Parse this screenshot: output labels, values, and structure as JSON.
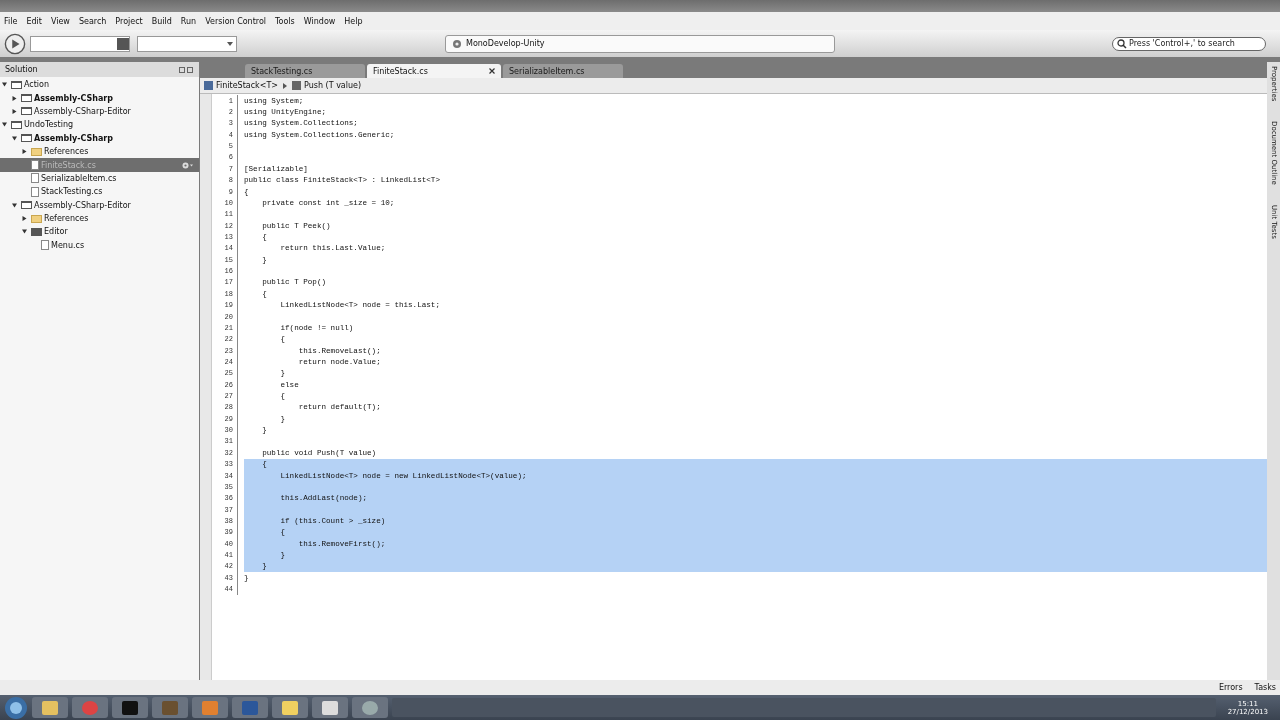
{
  "menu": [
    "File",
    "Edit",
    "View",
    "Search",
    "Project",
    "Build",
    "Run",
    "Version Control",
    "Tools",
    "Window",
    "Help"
  ],
  "toolbar": {
    "status": "MonoDevelop-Unity",
    "search": {
      "placeholder": "Press 'Control+,' to search"
    }
  },
  "solution": {
    "title": "Solution",
    "tree": [
      {
        "label": "Action",
        "kind": "solution",
        "startup": false,
        "expanded": true,
        "selected": false,
        "children": [
          {
            "label": "Assembly-CSharp",
            "kind": "project",
            "startup": true,
            "expanded": false,
            "selected": false
          },
          {
            "label": "Assembly-CSharp-Editor",
            "kind": "project",
            "startup": false,
            "expanded": false,
            "selected": false
          }
        ]
      },
      {
        "label": "UndoTesting",
        "kind": "solution",
        "startup": false,
        "expanded": true,
        "selected": false,
        "children": [
          {
            "label": "Assembly-CSharp",
            "kind": "project",
            "startup": true,
            "expanded": true,
            "selected": false,
            "children": [
              {
                "label": "References",
                "kind": "folder",
                "startup": false,
                "expanded": false,
                "selected": false
              },
              {
                "label": "FiniteStack.cs",
                "kind": "file",
                "startup": false,
                "selected": true
              },
              {
                "label": "SerializableItem.cs",
                "kind": "file",
                "startup": false,
                "selected": false
              },
              {
                "label": "StackTesting.cs",
                "kind": "file",
                "startup": false,
                "selected": false
              }
            ]
          },
          {
            "label": "Assembly-CSharp-Editor",
            "kind": "project",
            "startup": false,
            "expanded": true,
            "selected": false,
            "children": [
              {
                "label": "References",
                "kind": "folder",
                "startup": false,
                "expanded": false,
                "selected": false
              },
              {
                "label": "Editor",
                "kind": "dir",
                "startup": false,
                "expanded": true,
                "selected": false,
                "children": [
                  {
                    "label": "Menu.cs",
                    "kind": "file",
                    "startup": false,
                    "selected": false
                  }
                ]
              }
            ]
          }
        ]
      }
    ]
  },
  "tabs": [
    {
      "label": "StackTesting.cs",
      "selected": false
    },
    {
      "label": "FiniteStack.cs",
      "selected": true
    },
    {
      "label": "SerializableItem.cs",
      "selected": false
    }
  ],
  "breadcrumb": [
    "FiniteStack<T>",
    "Push (T value)"
  ],
  "editor": {
    "lines": [
      {
        "number": "1",
        "text": "using System;",
        "selected": false
      },
      {
        "number": "2",
        "text": "using UnityEngine;",
        "selected": false
      },
      {
        "number": "3",
        "text": "using System.Collections;",
        "selected": false
      },
      {
        "number": "4",
        "text": "using System.Collections.Generic;",
        "selected": false
      },
      {
        "number": "5",
        "selected": false
      },
      {
        "number": "6",
        "selected": false
      },
      {
        "number": "7",
        "text": "[Serializable]",
        "selected": false
      },
      {
        "number": "8",
        "text": "public class FiniteStack<T> : LinkedList<T>",
        "selected": false
      },
      {
        "number": "9",
        "text": "{",
        "selected": false
      },
      {
        "number": "10",
        "text": "    private const int _size = 10;",
        "selected": false
      },
      {
        "number": "11",
        "selected": false
      },
      {
        "number": "12",
        "text": "    public T Peek()",
        "selected": false
      },
      {
        "number": "13",
        "text": "    {",
        "selected": false
      },
      {
        "number": "14",
        "text": "        return this.Last.Value;",
        "selected": false
      },
      {
        "number": "15",
        "text": "    }",
        "selected": false
      },
      {
        "number": "16",
        "selected": false
      },
      {
        "number": "17",
        "text": "    public T Pop()",
        "selected": false
      },
      {
        "number": "18",
        "text": "    {",
        "selected": false
      },
      {
        "number": "19",
        "text": "        LinkedListNode<T> node = this.Last;",
        "selected": false
      },
      {
        "number": "20",
        "selected": false
      },
      {
        "number": "21",
        "text": "        if(node != null)",
        "selected": false
      },
      {
        "number": "22",
        "text": "        {",
        "selected": false
      },
      {
        "number": "23",
        "text": "            this.RemoveLast();",
        "selected": false
      },
      {
        "number": "24",
        "text": "            return node.Value;",
        "selected": false
      },
      {
        "number": "25",
        "text": "        }",
        "selected": false
      },
      {
        "number": "26",
        "text": "        else",
        "selected": false
      },
      {
        "number": "27",
        "text": "        {",
        "selected": false
      },
      {
        "number": "28",
        "text": "            return default(T);",
        "selected": false
      },
      {
        "number": "29",
        "text": "        }",
        "selected": false
      },
      {
        "number": "30",
        "text": "    }",
        "selected": false
      },
      {
        "number": "31",
        "selected": false
      },
      {
        "number": "32",
        "text": "    public void Push(T value)",
        "selected": false
      },
      {
        "number": "33",
        "text": "    {",
        "selected": true
      },
      {
        "number": "34",
        "text": "        LinkedListNode<T> node = new LinkedListNode<T>(value);",
        "selected": true
      },
      {
        "number": "35",
        "selected": true
      },
      {
        "number": "36",
        "text": "        this.AddLast(node);",
        "selected": true
      },
      {
        "number": "37",
        "selected": true
      },
      {
        "number": "38",
        "text": "        if (this.Count > _size)",
        "selected": true
      },
      {
        "number": "39",
        "text": "        {",
        "selected": true
      },
      {
        "number": "40",
        "text": "            this.RemoveFirst();",
        "selected": true
      },
      {
        "number": "41",
        "text": "        }",
        "selected": true
      },
      {
        "number": "42",
        "text": "    }",
        "selected": true
      },
      {
        "number": "43",
        "text": "}",
        "selected": false
      },
      {
        "number": "44",
        "selected": false
      }
    ]
  },
  "side_pads": [
    "Properties",
    "Document Outline",
    "Unit Tests"
  ],
  "status_bar": [
    "Errors",
    "Tasks"
  ],
  "taskbar": {
    "time": "15:11",
    "date": "27/12/2013"
  }
}
